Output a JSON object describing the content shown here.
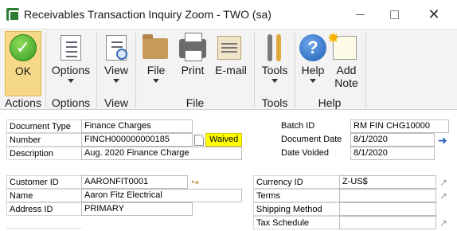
{
  "window": {
    "title": "Receivables Transaction Inquiry Zoom  -  TWO (sa)"
  },
  "ribbon": {
    "ok": "OK",
    "options": "Options",
    "view": "View",
    "file": "File",
    "print": "Print",
    "email": "E-mail",
    "tools": "Tools",
    "help": "Help",
    "add_note_line1": "Add",
    "add_note_line2": "Note",
    "groups": {
      "actions": "Actions",
      "options": "Options",
      "view": "View",
      "file": "File",
      "tools": "Tools",
      "help": "Help"
    }
  },
  "form": {
    "document_type": {
      "label": "Document Type",
      "value": "Finance Charges"
    },
    "number": {
      "label": "Number",
      "value": "FINCH000000000185",
      "status": "Waived"
    },
    "description": {
      "label": "Description",
      "value": "Aug. 2020 Finance Charge"
    },
    "batch_id": {
      "label": "Batch ID",
      "value": "RM FIN CHG10000"
    },
    "document_date": {
      "label": "Document Date",
      "value": "8/1/2020"
    },
    "date_voided": {
      "label": "Date Voided",
      "value": "8/1/2020"
    },
    "customer_id": {
      "label": "Customer ID",
      "value": "AARONFIT0001"
    },
    "name": {
      "label": "Name",
      "value": "Aaron Fitz Electrical"
    },
    "address_id": {
      "label": "Address ID",
      "value": "PRIMARY"
    },
    "currency_id": {
      "label": "Currency ID",
      "value": "Z-US$"
    },
    "terms": {
      "label": "Terms",
      "value": ""
    },
    "shipping_method": {
      "label": "Shipping Method",
      "value": ""
    },
    "tax_schedule": {
      "label": "Tax Schedule",
      "value": ""
    }
  }
}
